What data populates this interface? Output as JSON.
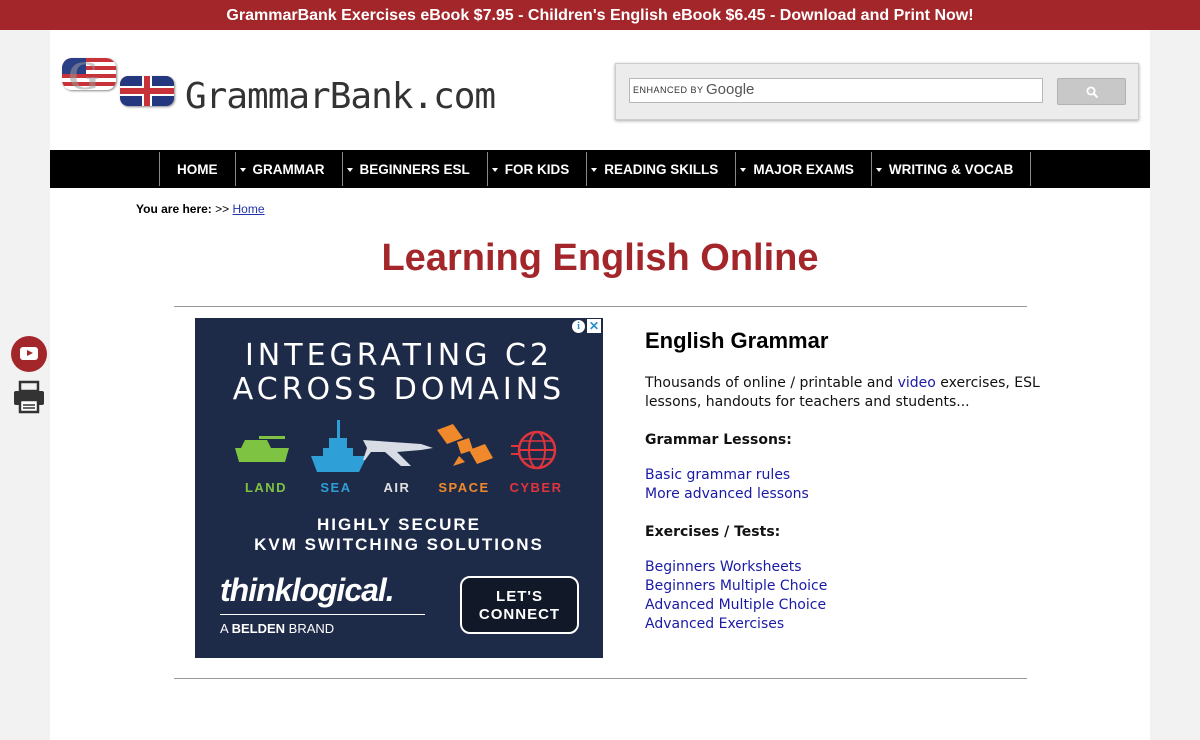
{
  "promo_banner": "GrammarBank Exercises eBook $7.95 - Children's English eBook $6.45 - Download and Print Now!",
  "logo": {
    "text": "GrammarBank.com",
    "badge_letters": "G"
  },
  "search": {
    "enhanced_label": "ENHANCED BY",
    "google_label": "Google"
  },
  "nav": {
    "items": [
      {
        "label": "HOME",
        "dropdown": false
      },
      {
        "label": "GRAMMAR",
        "dropdown": true
      },
      {
        "label": "BEGINNERS ESL",
        "dropdown": true
      },
      {
        "label": "FOR KIDS",
        "dropdown": true
      },
      {
        "label": "READING SKILLS",
        "dropdown": true
      },
      {
        "label": "MAJOR EXAMS",
        "dropdown": true
      },
      {
        "label": "WRITING & VOCAB",
        "dropdown": true
      }
    ]
  },
  "breadcrumb": {
    "prefix": "You are here:",
    "separator": ">>",
    "home": "Home"
  },
  "page_title": "Learning English Online",
  "ad": {
    "headline_1": "INTEGRATING C2",
    "headline_2": "ACROSS DOMAINS",
    "domains": [
      {
        "label": "LAND",
        "color": "#7fc342"
      },
      {
        "label": "SEA",
        "color": "#2f9fd8"
      },
      {
        "label": "AIR",
        "color": "#e0e0e0"
      },
      {
        "label": "SPACE",
        "color": "#f0892b"
      },
      {
        "label": "CYBER",
        "color": "#e0343d"
      }
    ],
    "sub_1": "HIGHLY SECURE",
    "sub_2": "KVM SWITCHING SOLUTIONS",
    "brand": "thinklogical.",
    "brand_sub_prefix": "A",
    "brand_sub_bold": "BELDEN",
    "brand_sub_suffix": "BRAND",
    "cta_1": "LET'S",
    "cta_2": "CONNECT",
    "info_glyph": "i",
    "close_glyph": "✕"
  },
  "content": {
    "heading": "English Grammar",
    "intro_before": "Thousands of online / printable and ",
    "intro_link": "video",
    "intro_after": " exercises, ESL lessons, handouts for teachers and students...",
    "lessons_heading": "Grammar Lessons:",
    "lessons": [
      "Basic grammar rules",
      "More advanced lessons"
    ],
    "exercises_heading": "Exercises / Tests:",
    "exercises": [
      "Beginners Worksheets",
      "Beginners Multiple Choice",
      "Advanced Multiple Choice",
      "Advanced Exercises"
    ]
  },
  "colors": {
    "accent": "#a3262b",
    "link": "#1a1aa6",
    "nav_bg": "#000000"
  }
}
